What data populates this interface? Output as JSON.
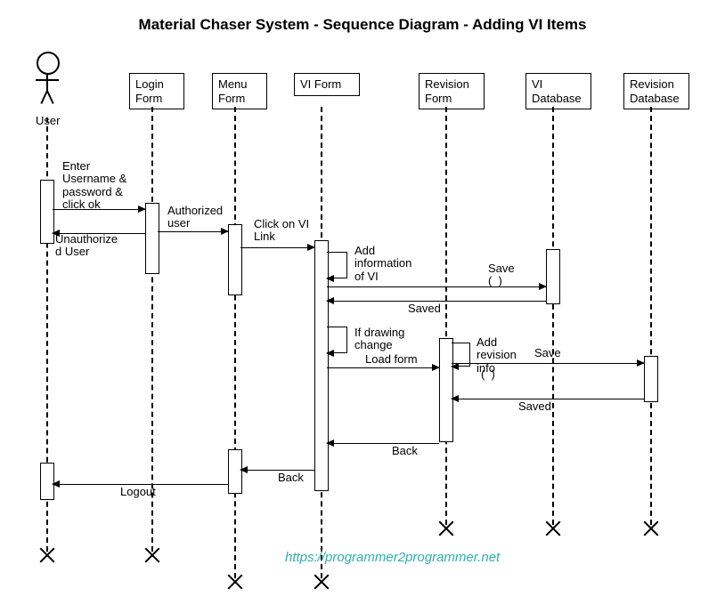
{
  "title": "Material Chaser System - Sequence Diagram - Adding VI Items",
  "actor": {
    "label": "User"
  },
  "participants": {
    "login": "Login\nForm",
    "menu": "Menu\nForm",
    "viform": "VI Form",
    "revform": "Revision\nForm",
    "vidb": "VI\nDatabase",
    "revdb": "Revision\nDatabase"
  },
  "messages": {
    "enter": "Enter\nUsername &\npassword &\nclick ok",
    "unauth": "Unauthorize\nd User",
    "auth": "Authorized\nuser",
    "click_vi": "Click on VI\nLink",
    "add_vi": "Add\ninformation\nof VI",
    "save1": "Save\n(  )",
    "saved1": "Saved",
    "if_drawing": "If drawing\nchange",
    "load_form": "Load form",
    "add_rev": "Add\nrevision\ninfo",
    "save2": "Save",
    "paren": "(  )",
    "saved2": "Saved",
    "back1": "Back",
    "back2": "Back",
    "logout": "Logout"
  },
  "watermark": "https://programmer2programmer.net"
}
